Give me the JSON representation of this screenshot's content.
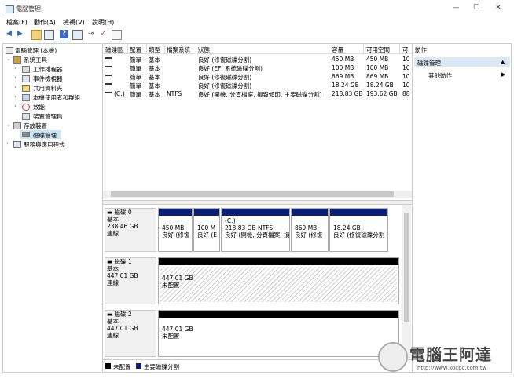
{
  "window": {
    "title": "電腦管理",
    "min": "—",
    "max": "☐",
    "close": "✕"
  },
  "menu": [
    "檔案(F)",
    "動作(A)",
    "檢視(V)",
    "說明(H)"
  ],
  "tree": {
    "root": "電腦管理 (本機)",
    "system_tools": "系統工具",
    "task_scheduler": "工作排程器",
    "event_viewer": "事件檢視器",
    "shared_folders": "共用資料夾",
    "local_users": "本機使用者和群組",
    "performance": "效能",
    "device_manager": "裝置管理員",
    "storage": "存放裝置",
    "disk_management": "磁碟管理",
    "services": "服務與應用程式"
  },
  "volume_table": {
    "headers": [
      "磁碟區",
      "配置",
      "類型",
      "檔案系統",
      "狀態",
      "容量",
      "可用空間",
      "可"
    ],
    "rows": [
      {
        "vol": "",
        "layout": "簡單",
        "type": "基本",
        "fs": "",
        "status": "良好 (修復磁碟分割)",
        "cap": "450 MB",
        "free": "450 MB",
        "pct": "10"
      },
      {
        "vol": "",
        "layout": "簡單",
        "type": "基本",
        "fs": "",
        "status": "良好 (EFI 系統磁碟分割)",
        "cap": "100 MB",
        "free": "100 MB",
        "pct": "10"
      },
      {
        "vol": "",
        "layout": "簡單",
        "type": "基本",
        "fs": "",
        "status": "良好 (修復磁碟分割)",
        "cap": "869 MB",
        "free": "869 MB",
        "pct": "10"
      },
      {
        "vol": "",
        "layout": "簡單",
        "type": "基本",
        "fs": "",
        "status": "良好 (修復磁碟分割)",
        "cap": "18.24 GB",
        "free": "18.24 GB",
        "pct": "10"
      },
      {
        "vol": "(C:)",
        "layout": "簡單",
        "type": "基本",
        "fs": "NTFS",
        "status": "良好 (開機, 分頁檔案, 損毀傾印, 主要磁碟分割)",
        "cap": "218.83 GB",
        "free": "193.62 GB",
        "pct": "88"
      }
    ]
  },
  "disks": [
    {
      "name": "磁碟 0",
      "type": "基本",
      "size": "238.46 GB",
      "state": "連線",
      "partitions": [
        {
          "l1": "",
          "l2": "450 MB",
          "l3": "良好 (修復"
        },
        {
          "l1": "",
          "l2": "100 M",
          "l3": "良好 (E"
        },
        {
          "l1": "(C:)",
          "l2": "218.83 GB NTFS",
          "l3": "良好 (開機, 分頁檔案, 損"
        },
        {
          "l1": "",
          "l2": "869 MB",
          "l3": "良好 (修復"
        },
        {
          "l1": "",
          "l2": "18.24 GB",
          "l3": "良好 (修復磁碟分割"
        }
      ]
    },
    {
      "name": "磁碟 1",
      "type": "基本",
      "size": "447.01 GB",
      "state": "連線",
      "partitions": [
        {
          "l1": "447.01 GB",
          "l2": "未配置"
        }
      ]
    },
    {
      "name": "磁碟 2",
      "type": "基本",
      "size": "447.01 GB",
      "state": "連線",
      "partitions": [
        {
          "l1": "447.01 GB",
          "l2": "未配置"
        }
      ]
    }
  ],
  "legend": {
    "unallocated": "未配置",
    "primary": "主要磁碟分割"
  },
  "actions": {
    "header": "動作",
    "selected": "磁碟管理",
    "more": "其他動作",
    "arrow": "▶"
  },
  "colors": {
    "primary_partition": "#0a1f7a",
    "unallocated": "#000000",
    "selection": "#dce8f5"
  },
  "watermark": {
    "text": "電腦王阿達",
    "url": "http://www.kocpc.com.tw"
  }
}
